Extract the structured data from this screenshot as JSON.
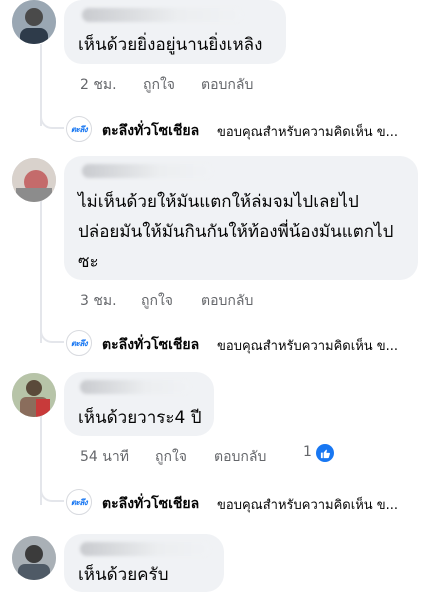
{
  "comments": [
    {
      "text_lines": [
        "เห็นด้วยยิ่งอยู่นานยิ่งเหลิง"
      ],
      "time": "2 ชม.",
      "like_label": "ถูกใจ",
      "reply_label": "ตอบกลับ",
      "page_reply": {
        "logo": "ตะลึง",
        "name": "ตะลึงทั่วโซเชียล",
        "text": "ขอบคุณสำหรับความคิดเห็น ข..."
      }
    },
    {
      "text_lines": [
        "ไม่เห็นด้วยให้มันแตกให้ล่มจมไปเลยไป",
        "ปล่อยมันให้มันกินกันให้ท้องพี่น้องมันแตกไป",
        "ซะ"
      ],
      "time": "3 ชม.",
      "like_label": "ถูกใจ",
      "reply_label": "ตอบกลับ",
      "page_reply": {
        "logo": "ตะลึง",
        "name": "ตะลึงทั่วโซเชียล",
        "text": "ขอบคุณสำหรับความคิดเห็น ข..."
      }
    },
    {
      "text_lines": [
        "เห็นด้วยวาระ4 ปี"
      ],
      "time": "54 นาที",
      "like_label": "ถูกใจ",
      "reply_label": "ตอบกลับ",
      "reaction_count": "1",
      "page_reply": {
        "logo": "ตะลึง",
        "name": "ตะลึงทั่วโซเชียล",
        "text": "ขอบคุณสำหรับความคิดเห็น ข..."
      }
    },
    {
      "text_lines": [
        "เห็นด้วยครับ"
      ]
    }
  ],
  "icons": {
    "reaction": "thumbs-up-icon"
  },
  "colors": {
    "bubble": "#f0f2f5",
    "meta": "#65676b",
    "like_blue": "#1877f2"
  }
}
